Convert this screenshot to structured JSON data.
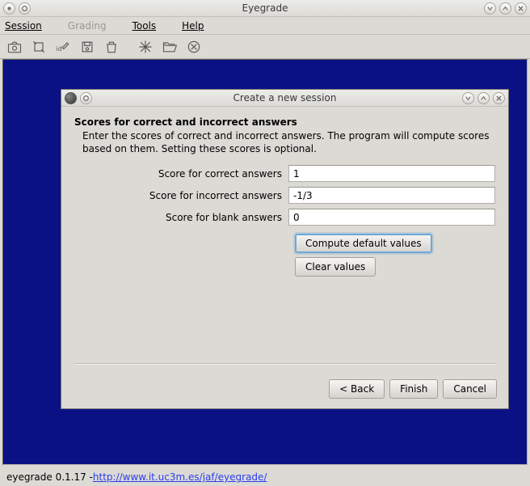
{
  "window": {
    "title": "Eyegrade"
  },
  "menu": {
    "session": "Session",
    "grading": "Grading",
    "tools": "Tools",
    "help": "Help"
  },
  "dialog": {
    "title": "Create a new session",
    "heading": "Scores for correct and incorrect answers",
    "subtext": "Enter the scores of correct and incorrect answers. The program will compute scores based on them. Setting these scores is optional.",
    "labels": {
      "correct": "Score for correct answers",
      "incorrect": "Score for incorrect answers",
      "blank": "Score for blank answers"
    },
    "values": {
      "correct": "1",
      "incorrect": "-1/3",
      "blank": "0"
    },
    "buttons": {
      "compute": "Compute default values",
      "clear": "Clear values"
    },
    "nav": {
      "back": "< Back",
      "finish": "Finish",
      "cancel": "Cancel"
    }
  },
  "status": {
    "prefix": "eyegrade 0.1.17 - ",
    "link": "http://www.it.uc3m.es/jaf/eyegrade/"
  }
}
